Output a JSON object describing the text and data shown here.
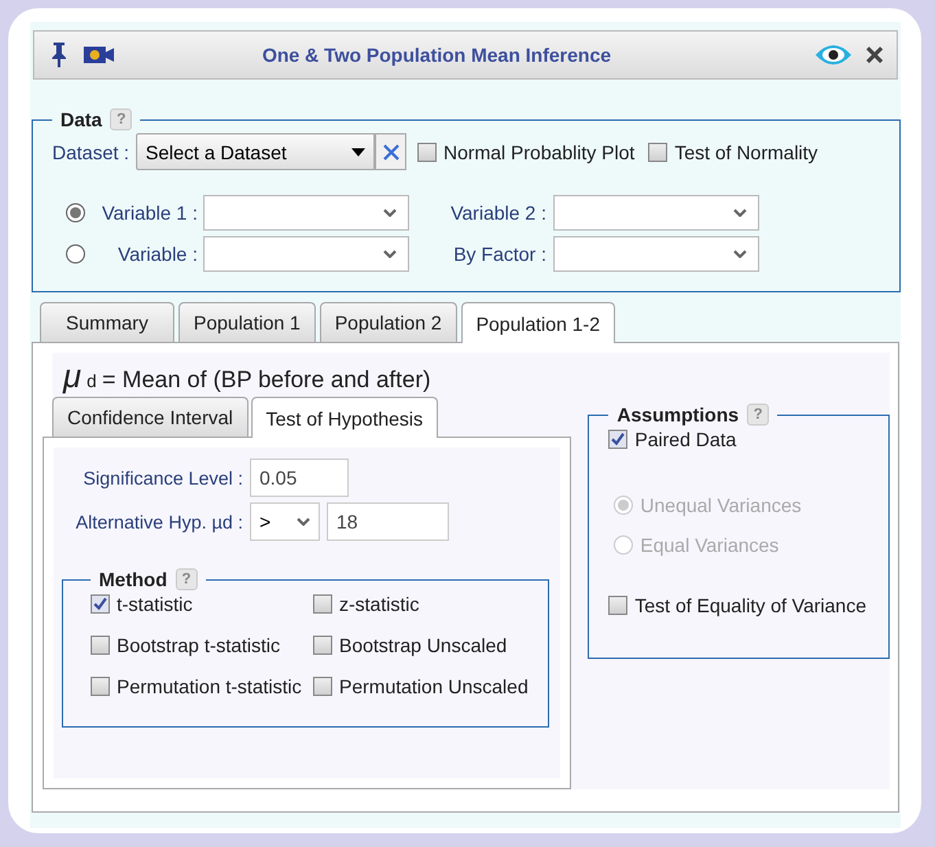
{
  "window": {
    "title": "One & Two Population Mean Inference"
  },
  "data": {
    "legend": "Data",
    "help": "?",
    "dataset_label": "Dataset :",
    "dataset_value": "Select a Dataset",
    "options": [
      {
        "label": "Normal Probablity Plot",
        "checked": false
      },
      {
        "label": "Test of Normality",
        "checked": false
      }
    ],
    "variable_rows": [
      {
        "label": "Variable 1 :",
        "selected": true,
        "second_label": "Variable 2 :"
      },
      {
        "label": "Variable :",
        "selected": false,
        "second_label": "By Factor :"
      }
    ]
  },
  "tabs": [
    {
      "label": "Summary",
      "selected": false
    },
    {
      "label": "Population 1",
      "selected": false
    },
    {
      "label": "Population 2",
      "selected": false
    },
    {
      "label": "Population 1-2",
      "selected": true
    }
  ],
  "heading": {
    "symbol": "μ",
    "subscript": "d",
    "text": "= Mean of (BP before and after)"
  },
  "subtabs": [
    {
      "label": "Confidence Interval",
      "selected": false
    },
    {
      "label": "Test of Hypothesis",
      "selected": true
    }
  ],
  "significance": {
    "label": "Significance Level :",
    "value": "0.05"
  },
  "alternative": {
    "label": "Alternative Hyp. µd :",
    "operator": ">",
    "value": "18"
  },
  "method": {
    "legend": "Method",
    "help": "?",
    "options": [
      {
        "label": "t-statistic",
        "checked": true
      },
      {
        "label": "z-statistic",
        "checked": false
      },
      {
        "label": "Bootstrap t-statistic",
        "checked": false
      },
      {
        "label": "Bootstrap Unscaled",
        "checked": false
      },
      {
        "label": "Permutation t-statistic",
        "checked": false
      },
      {
        "label": "Permutation Unscaled",
        "checked": false
      }
    ]
  },
  "assumptions": {
    "legend": "Assumptions",
    "help": "?",
    "paired": {
      "label": "Paired Data",
      "checked": true
    },
    "variances": [
      {
        "label": "Unequal Variances",
        "selected": true,
        "disabled": true
      },
      {
        "label": "Equal Variances",
        "selected": false,
        "disabled": true
      }
    ],
    "equality": {
      "label": "Test of Equality of Variance",
      "checked": false
    }
  }
}
